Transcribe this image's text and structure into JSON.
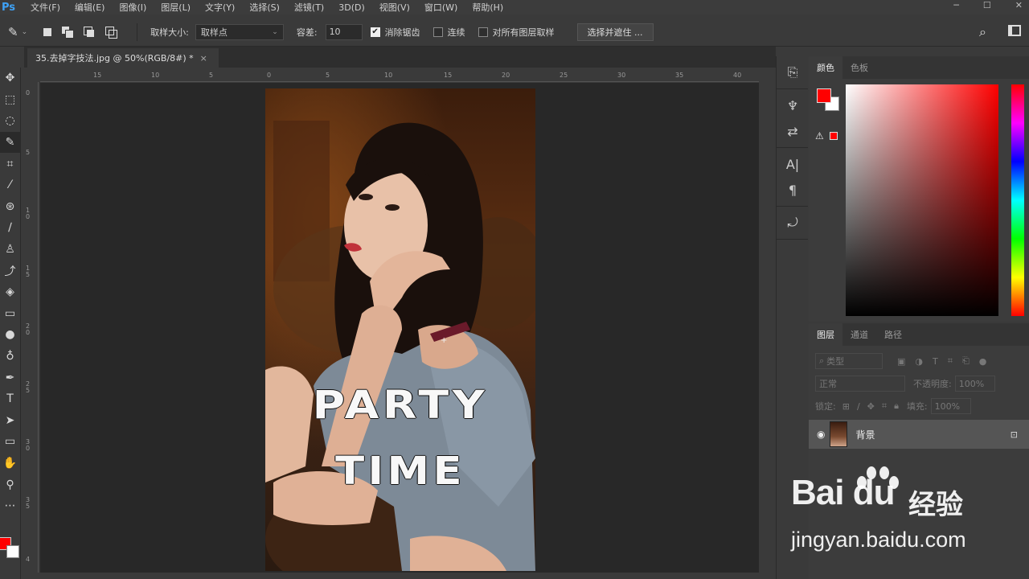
{
  "app": {
    "logo": "Ps"
  },
  "menu": [
    "文件(F)",
    "编辑(E)",
    "图像(I)",
    "图层(L)",
    "文字(Y)",
    "选择(S)",
    "滤镜(T)",
    "3D(D)",
    "视图(V)",
    "窗口(W)",
    "帮助(H)"
  ],
  "options": {
    "sample_size_label": "取样大小:",
    "sample_size_value": "取样点",
    "tolerance_label": "容差:",
    "tolerance_value": "10",
    "antialias_label": "消除锯齿",
    "contiguous_label": "连续",
    "all_layers_label": "对所有图层取样",
    "select_mask_button": "选择并遮住 ..."
  },
  "document": {
    "tab_title": "35.去掉字技法.jpg @ 50%(RGB/8#) *",
    "close": "×",
    "text_line1": "PARTY",
    "text_line2": "TIME",
    "ruler_top": [
      "15",
      "10",
      "5",
      "0",
      "5",
      "10",
      "15",
      "20",
      "25",
      "30",
      "35",
      "40"
    ],
    "ruler_left": [
      "0",
      "5",
      "1 0",
      "1 5",
      "2 0",
      "2 5",
      "3 0",
      "3 5",
      "4"
    ]
  },
  "colors": {
    "foreground": "#ff0000",
    "background": "#ffffff"
  },
  "color_panel": {
    "tabs": [
      "颜色",
      "色板"
    ]
  },
  "layers_panel": {
    "tabs": [
      "图层",
      "通道",
      "路径"
    ],
    "filter_placeholder": "类型",
    "blend_mode": "正常",
    "opacity_label": "不透明度:",
    "opacity_value": "100%",
    "lock_label": "锁定:",
    "fill_label": "填充:",
    "fill_value": "100%",
    "layer_name": "背景"
  },
  "watermark": {
    "brand": "Bai du",
    "cn": "经验",
    "url": "jingyan.baidu.com"
  }
}
